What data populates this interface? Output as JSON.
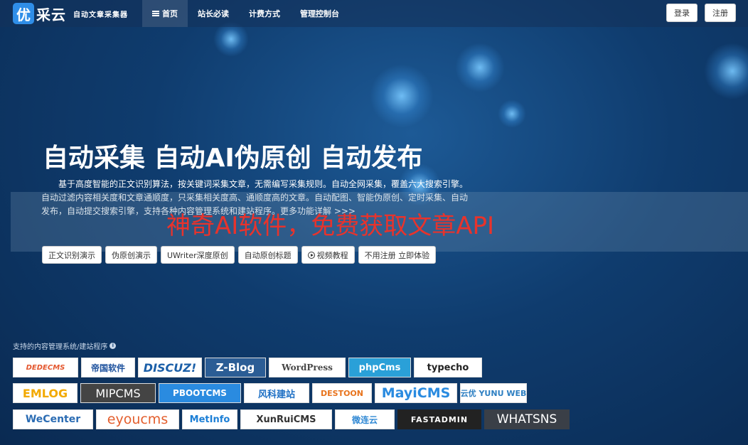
{
  "nav": {
    "logo_char": "优",
    "brand_name": "采云",
    "slogan": "自动文章采集器",
    "items": [
      {
        "label": "首页",
        "active": true
      },
      {
        "label": "站长必读"
      },
      {
        "label": "计费方式"
      },
      {
        "label": "管理控制台"
      }
    ],
    "login": "登录",
    "register": "注册"
  },
  "hero": {
    "title": "自动采集 自动AI伪原创 自动发布",
    "description": "基于高度智能的正文识别算法，按关键词采集文章，无需编写采集规则。自动全网采集，覆盖六大搜索引擎。自动过滤内容相关度和文章通顺度，只采集相关度高、通顺度高的文章。自动配图、智能伪原创、定时采集、自动发布，自动提交搜索引擎，支持各种内容管理系统和建站程序。更多功能详解 >>>",
    "overlay_text": "神奇AI软件，免费获取文章API",
    "buttons": [
      "正文识别演示",
      "伪原创演示",
      "UWriter深度原创",
      "自动原创标题",
      "视频教程",
      "不用注册 立即体验"
    ]
  },
  "cms": {
    "label": "支持的内容管理系统/建站程序",
    "rows": [
      [
        {
          "name": "DEDECMS",
          "color": "#e4572e"
        },
        {
          "name": "帝国软件",
          "color": "#1a4f9c"
        },
        {
          "name": "DISCUZ!",
          "color": "#1b5fa8"
        },
        {
          "name": "Z-Blog",
          "color": "#ffffff"
        },
        {
          "name": "WordPress",
          "color": "#464646"
        },
        {
          "name": "phpCms",
          "color": "#ffffff"
        },
        {
          "name": "typecho",
          "color": "#222222"
        }
      ],
      [
        {
          "name": "EMLOG",
          "color": "#f2a900"
        },
        {
          "name": "MIPCMS",
          "color": "#ffffff"
        },
        {
          "name": "PBOOTCMS",
          "color": "#ffffff"
        },
        {
          "name": "风科建站",
          "color": "#1d6fc4"
        },
        {
          "name": "DESTOON",
          "color": "#e8731c"
        },
        {
          "name": "MayiCMS",
          "color": "#2a8be0"
        },
        {
          "name": "云优 YUNU WEB",
          "color": "#2d7fc2"
        }
      ],
      [
        {
          "name": "WeCenter",
          "color": "#2b6cb3"
        },
        {
          "name": "eyoucms",
          "color": "#e35e2d"
        },
        {
          "name": "MetInfo",
          "color": "#1c7fd6"
        },
        {
          "name": "XunRuiCMS",
          "color": "#333333"
        },
        {
          "name": "微连云",
          "color": "#2f88d4"
        },
        {
          "name": "FASTADMIN",
          "color": "#ffffff"
        },
        {
          "name": "WHATSNS",
          "color": "#ffffff"
        }
      ]
    ]
  }
}
